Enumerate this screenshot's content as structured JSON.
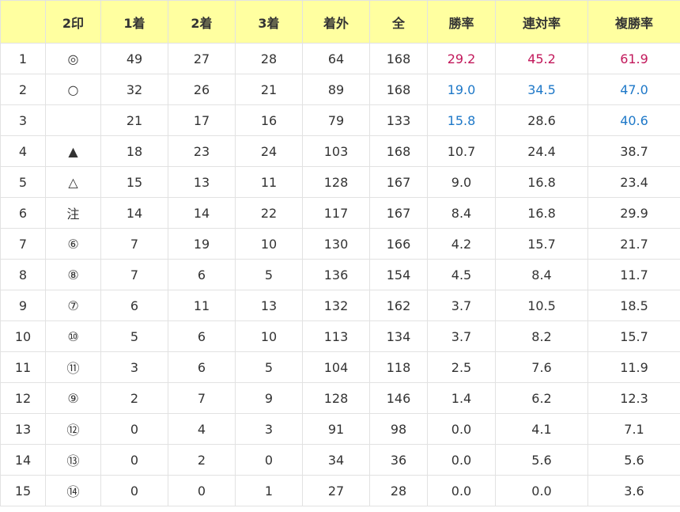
{
  "colors": {
    "header_bg": "#ffffa0",
    "highlight_red": "#c2185b",
    "highlight_blue": "#1e78c8"
  },
  "columns": [
    "",
    "2印",
    "1着",
    "2着",
    "3着",
    "着外",
    "全",
    "勝率",
    "連対率",
    "複勝率"
  ],
  "rows": [
    {
      "cells": [
        "1",
        "◎",
        "49",
        "27",
        "28",
        "64",
        "168",
        "29.2",
        "45.2",
        "61.9"
      ],
      "styles": [
        "",
        "",
        "",
        "",
        "",
        "",
        "",
        "red",
        "red",
        "red"
      ]
    },
    {
      "cells": [
        "2",
        "○",
        "32",
        "26",
        "21",
        "89",
        "168",
        "19.0",
        "34.5",
        "47.0"
      ],
      "styles": [
        "",
        "",
        "",
        "",
        "",
        "",
        "",
        "blue",
        "blue",
        "blue"
      ]
    },
    {
      "cells": [
        "3",
        "",
        "21",
        "17",
        "16",
        "79",
        "133",
        "15.8",
        "28.6",
        "40.6"
      ],
      "styles": [
        "",
        "",
        "",
        "",
        "",
        "",
        "",
        "blue",
        "",
        "blue"
      ]
    },
    {
      "cells": [
        "4",
        "▲",
        "18",
        "23",
        "24",
        "103",
        "168",
        "10.7",
        "24.4",
        "38.7"
      ],
      "styles": []
    },
    {
      "cells": [
        "5",
        "△",
        "15",
        "13",
        "11",
        "128",
        "167",
        "9.0",
        "16.8",
        "23.4"
      ],
      "styles": []
    },
    {
      "cells": [
        "6",
        "注",
        "14",
        "14",
        "22",
        "117",
        "167",
        "8.4",
        "16.8",
        "29.9"
      ],
      "styles": []
    },
    {
      "cells": [
        "7",
        "⑥",
        "7",
        "19",
        "10",
        "130",
        "166",
        "4.2",
        "15.7",
        "21.7"
      ],
      "styles": []
    },
    {
      "cells": [
        "8",
        "⑧",
        "7",
        "6",
        "5",
        "136",
        "154",
        "4.5",
        "8.4",
        "11.7"
      ],
      "styles": []
    },
    {
      "cells": [
        "9",
        "⑦",
        "6",
        "11",
        "13",
        "132",
        "162",
        "3.7",
        "10.5",
        "18.5"
      ],
      "styles": []
    },
    {
      "cells": [
        "10",
        "⑩",
        "5",
        "6",
        "10",
        "113",
        "134",
        "3.7",
        "8.2",
        "15.7"
      ],
      "styles": []
    },
    {
      "cells": [
        "11",
        "⑪",
        "3",
        "6",
        "5",
        "104",
        "118",
        "2.5",
        "7.6",
        "11.9"
      ],
      "styles": []
    },
    {
      "cells": [
        "12",
        "⑨",
        "2",
        "7",
        "9",
        "128",
        "146",
        "1.4",
        "6.2",
        "12.3"
      ],
      "styles": []
    },
    {
      "cells": [
        "13",
        "⑫",
        "0",
        "4",
        "3",
        "91",
        "98",
        "0.0",
        "4.1",
        "7.1"
      ],
      "styles": []
    },
    {
      "cells": [
        "14",
        "⑬",
        "0",
        "2",
        "0",
        "34",
        "36",
        "0.0",
        "5.6",
        "5.6"
      ],
      "styles": []
    },
    {
      "cells": [
        "15",
        "⑭",
        "0",
        "0",
        "1",
        "27",
        "28",
        "0.0",
        "0.0",
        "3.6"
      ],
      "styles": []
    }
  ]
}
